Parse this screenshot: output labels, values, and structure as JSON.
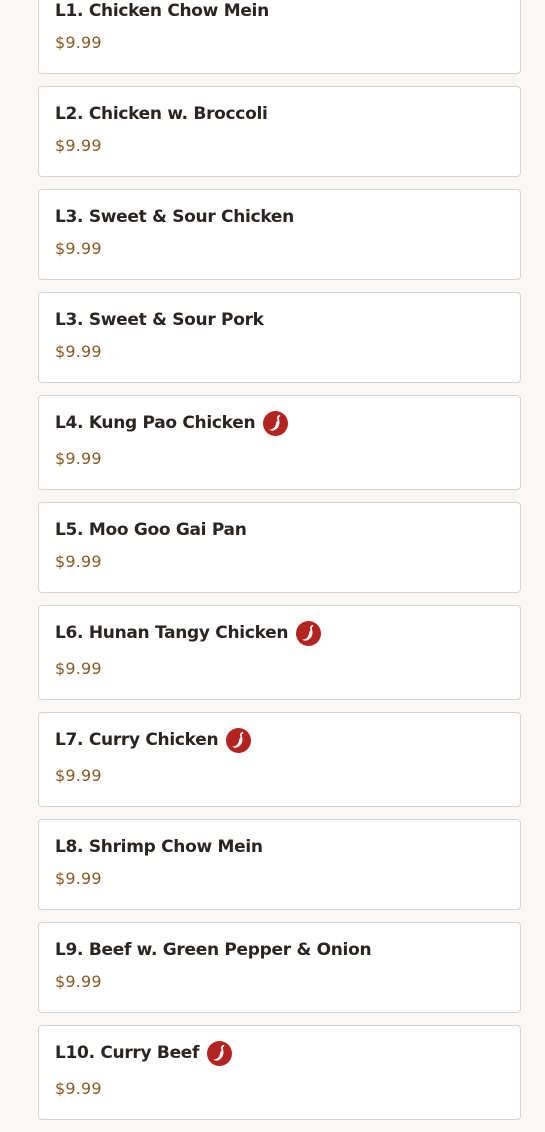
{
  "colors": {
    "background": "#f9f8f6",
    "card": "#ffffff",
    "card_border": "#d7d4cf",
    "item_name": "#2a2422",
    "price": "#8a5a24",
    "spicy_badge": "#b3231f"
  },
  "menu": {
    "items": [
      {
        "name": "L1. Chicken Chow Mein",
        "price": "$9.99",
        "spicy": false
      },
      {
        "name": "L2. Chicken w. Broccoli",
        "price": "$9.99",
        "spicy": false
      },
      {
        "name": "L3. Sweet & Sour Chicken",
        "price": "$9.99",
        "spicy": false
      },
      {
        "name": "L3. Sweet & Sour Pork",
        "price": "$9.99",
        "spicy": false
      },
      {
        "name": "L4. Kung Pao Chicken",
        "price": "$9.99",
        "spicy": true,
        "icon": "chili-pepper-icon"
      },
      {
        "name": "L5. Moo Goo Gai Pan",
        "price": "$9.99",
        "spicy": false
      },
      {
        "name": "L6. Hunan Tangy Chicken",
        "price": "$9.99",
        "spicy": true,
        "icon": "chili-pepper-icon"
      },
      {
        "name": "L7. Curry Chicken",
        "price": "$9.99",
        "spicy": true,
        "icon": "chili-pepper-icon"
      },
      {
        "name": "L8. Shrimp Chow Mein",
        "price": "$9.99",
        "spicy": false
      },
      {
        "name": "L9. Beef w. Green Pepper & Onion",
        "price": "$9.99",
        "spicy": false
      },
      {
        "name": "L10. Curry Beef",
        "price": "$9.99",
        "spicy": true,
        "icon": "chili-pepper-icon"
      }
    ]
  }
}
